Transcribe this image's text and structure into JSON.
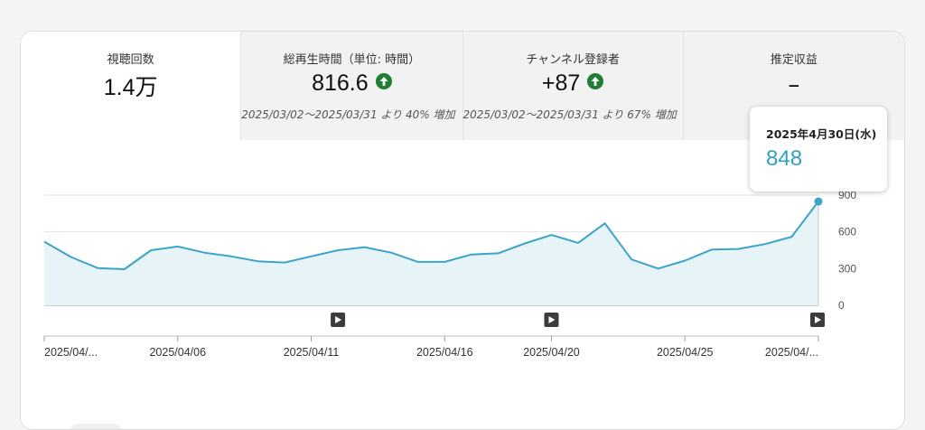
{
  "metrics": [
    {
      "label": "視聴回数",
      "value": "1.4万",
      "trend": null,
      "compare": ""
    },
    {
      "label": "総再生時間（単位: 時間）",
      "value": "816.6",
      "trend": "up",
      "compare": "2025/03/02〜2025/03/31 より 40% 増加"
    },
    {
      "label": "チャンネル登録者",
      "value": "+87",
      "trend": "up",
      "compare": "2025/03/02〜2025/03/31 より 67% 増加"
    },
    {
      "label": "推定収益",
      "value": "–",
      "trend": null,
      "compare": ""
    }
  ],
  "tooltip": {
    "date": "2025年4月30日(水)",
    "value": "848"
  },
  "colors": {
    "line": "#3ba4c9",
    "area": "#e6f4f7",
    "trend_up": "#1e7e34",
    "tooltip_value": "#2ea0c8"
  },
  "icons": {
    "trend": "arrow-up-circle-icon",
    "marker": "play-marker-icon"
  },
  "chart_data": {
    "type": "area",
    "x": [
      "2025/04/01",
      "2025/04/02",
      "2025/04/03",
      "2025/04/04",
      "2025/04/05",
      "2025/04/06",
      "2025/04/07",
      "2025/04/08",
      "2025/04/09",
      "2025/04/10",
      "2025/04/11",
      "2025/04/12",
      "2025/04/13",
      "2025/04/14",
      "2025/04/15",
      "2025/04/16",
      "2025/04/17",
      "2025/04/18",
      "2025/04/19",
      "2025/04/20",
      "2025/04/21",
      "2025/04/22",
      "2025/04/23",
      "2025/04/24",
      "2025/04/25",
      "2025/04/26",
      "2025/04/27",
      "2025/04/28",
      "2025/04/29",
      "2025/04/30"
    ],
    "values": [
      520,
      395,
      305,
      295,
      450,
      480,
      430,
      400,
      360,
      350,
      400,
      450,
      475,
      430,
      355,
      355,
      415,
      425,
      505,
      575,
      510,
      670,
      375,
      300,
      365,
      455,
      460,
      500,
      560,
      848
    ],
    "ylim": [
      0,
      900
    ],
    "yticks": [
      "0",
      "300",
      "600",
      "900"
    ],
    "xtick_labels": [
      "2025/04/...",
      "2025/04/06",
      "2025/04/11",
      "2025/04/16",
      "2025/04/20",
      "2025/04/25",
      "2025/04/..."
    ],
    "xtick_index": [
      0,
      5,
      10,
      15,
      19,
      24,
      29
    ],
    "markers_index": [
      11,
      19,
      29
    ],
    "grid": true
  }
}
